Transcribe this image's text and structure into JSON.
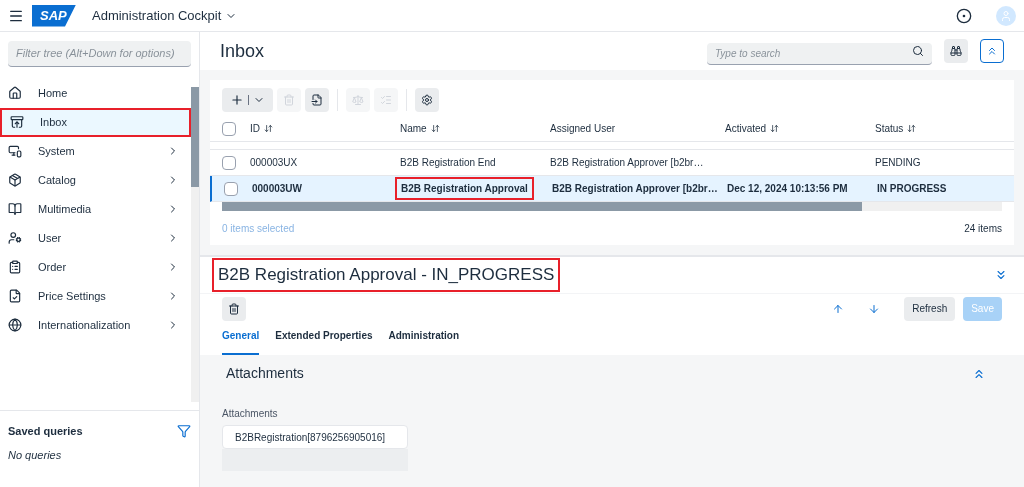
{
  "header": {
    "logo": "SAP",
    "app_title": "Administration Cockpit"
  },
  "sidebar": {
    "filter_placeholder": "Filter tree (Alt+Down for options)",
    "items": [
      {
        "label": "Home",
        "has_children": false,
        "selected": false,
        "annotated": false
      },
      {
        "label": "Inbox",
        "has_children": false,
        "selected": true,
        "annotated": true
      },
      {
        "label": "System",
        "has_children": true,
        "selected": false,
        "annotated": false
      },
      {
        "label": "Catalog",
        "has_children": true,
        "selected": false,
        "annotated": false
      },
      {
        "label": "Multimedia",
        "has_children": true,
        "selected": false,
        "annotated": false
      },
      {
        "label": "User",
        "has_children": true,
        "selected": false,
        "annotated": false
      },
      {
        "label": "Order",
        "has_children": true,
        "selected": false,
        "annotated": false
      },
      {
        "label": "Price Settings",
        "has_children": true,
        "selected": false,
        "annotated": false
      },
      {
        "label": "Internationalization",
        "has_children": true,
        "selected": false,
        "annotated": false
      }
    ],
    "saved_queries": {
      "title": "Saved queries",
      "empty_text": "No queries"
    }
  },
  "list": {
    "title": "Inbox",
    "search_placeholder": "Type to search",
    "all_checked": false,
    "columns": [
      {
        "label": "ID",
        "sortable": true
      },
      {
        "label": "Name",
        "sortable": true
      },
      {
        "label": "Assigned User",
        "sortable": false
      },
      {
        "label": "Activated",
        "sortable": true
      },
      {
        "label": "Status",
        "sortable": true
      }
    ],
    "rows": [
      {
        "cells": [
          "000003UX",
          "B2B Registration End",
          "B2B Registration Approver [b2br…",
          "",
          "PENDING"
        ],
        "selected": false,
        "checked": false,
        "name_annotated": false
      },
      {
        "cells": [
          "000003UW",
          "B2B Registration Approval",
          "B2B Registration Approver [b2br…",
          "Dec 12, 2024 10:13:56 PM",
          "IN PROGRESS"
        ],
        "selected": true,
        "checked": false,
        "name_annotated": true
      }
    ],
    "selection_text": "0 items selected",
    "count_text": "24 items"
  },
  "detail": {
    "title": "B2B Registration Approval - IN_PROGRESS",
    "title_annotated": true,
    "refresh_label": "Refresh",
    "save_label": "Save",
    "save_disabled": true,
    "tabs": [
      {
        "label": "General",
        "selected": true
      },
      {
        "label": "Extended Properties",
        "selected": false
      },
      {
        "label": "Administration",
        "selected": false
      }
    ],
    "section_title": "Attachments",
    "field_label": "Attachments",
    "field_value": "B2BRegistration[8796256905016]"
  }
}
